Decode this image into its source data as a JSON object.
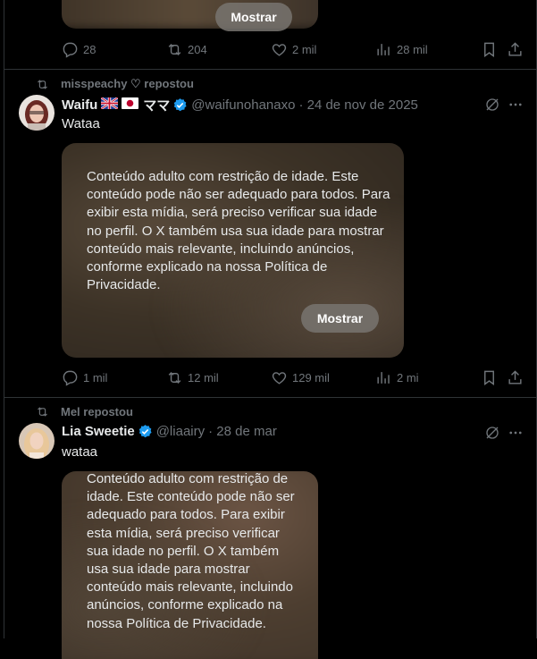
{
  "tweet0": {
    "show_label": "Mostrar",
    "replies": "28",
    "reposts": "204",
    "likes": "2 mil",
    "views": "28 mil"
  },
  "tweet1": {
    "repost_by": "misspeachy ♡ repostou",
    "name": "Waifu",
    "name_suffix": "ママ",
    "handle": "@waifunohanaxo",
    "date": "· 24 de nov de 2025",
    "text": "Wataa",
    "media_warning": "Conteúdo adulto com restrição de idade. Este conteúdo pode não ser adequado para todos. Para exibir esta mídia, será preciso verificar sua idade no perfil. O X também usa sua idade para mostrar conteúdo mais relevante, incluindo anúncios, conforme explicado na nossa Política de Privacidade.",
    "show_label": "Mostrar",
    "replies": "1 mil",
    "reposts": "12 mil",
    "likes": "129 mil",
    "views": "2 mi"
  },
  "tweet2": {
    "repost_by": "Mel repostou",
    "name": "Lia Sweetie",
    "handle": "@liaairy",
    "date": "· 28 de mar",
    "text": "wataa",
    "media_warning": "Conteúdo adulto com restrição de idade. Este conteúdo pode não ser adequado para todos. Para exibir esta mídia, será preciso verificar sua idade no perfil. O X também usa sua idade para mostrar conteúdo mais relevante, incluindo anúncios, conforme explicado na nossa Política de Privacidade."
  },
  "colors": {
    "background": "#000000",
    "divider": "#2f3336",
    "muted": "#71767b",
    "text": "#e7e9ea",
    "verified": "#1d9bf0"
  }
}
